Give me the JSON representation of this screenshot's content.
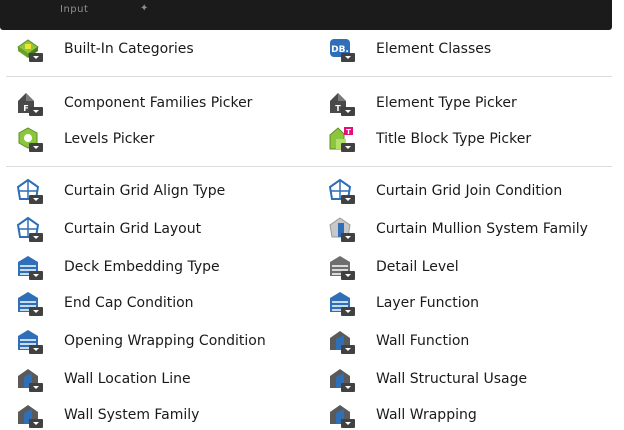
{
  "header": {
    "title": "Input",
    "pin_glyph": "✦"
  },
  "nodes": {
    "built_in_categories": {
      "label": "Built-In Categories",
      "icon": "categories-icon"
    },
    "element_classes": {
      "label": "Element Classes",
      "icon": "database-icon",
      "icon_text": "DB."
    },
    "component_families_picker": {
      "label": "Component Families Picker",
      "icon": "family-picker-icon",
      "icon_text": "F"
    },
    "element_type_picker": {
      "label": "Element Type Picker",
      "icon": "type-picker-icon",
      "icon_text": "T"
    },
    "levels_picker": {
      "label": "Levels Picker",
      "icon": "levels-icon"
    },
    "title_block_type_picker": {
      "label": "Title Block Type Picker",
      "icon": "title-block-icon",
      "icon_text": "T"
    },
    "curtain_grid_align_type": {
      "label": "Curtain Grid Align Type",
      "icon": "curtain-grid-icon"
    },
    "curtain_grid_join_condition": {
      "label": "Curtain Grid Join Condition",
      "icon": "curtain-grid-icon"
    },
    "curtain_grid_layout": {
      "label": "Curtain Grid Layout",
      "icon": "curtain-grid-icon"
    },
    "curtain_mullion_system_family": {
      "label": "Curtain Mullion System Family",
      "icon": "mullion-icon"
    },
    "deck_embedding_type": {
      "label": "Deck Embedding Type",
      "icon": "wall-layers-icon"
    },
    "detail_level": {
      "label": "Detail Level",
      "icon": "detail-level-icon"
    },
    "end_cap_condition": {
      "label": "End Cap Condition",
      "icon": "wall-layers-icon"
    },
    "layer_function": {
      "label": "Layer Function",
      "icon": "wall-layers-icon"
    },
    "opening_wrapping_condition": {
      "label": "Opening Wrapping Condition",
      "icon": "wall-layers-icon"
    },
    "wall_function": {
      "label": "Wall Function",
      "icon": "wall-icon"
    },
    "wall_location_line": {
      "label": "Wall Location Line",
      "icon": "wall-icon"
    },
    "wall_structural_usage": {
      "label": "Wall Structural Usage",
      "icon": "wall-icon"
    },
    "wall_system_family": {
      "label": "Wall System Family",
      "icon": "wall-icon"
    },
    "wall_wrapping": {
      "label": "Wall Wrapping",
      "icon": "wall-icon"
    }
  },
  "colors": {
    "header_bg": "#1b1b1b",
    "green": "#8cc63f",
    "blue": "#2f6fb7",
    "grey": "#5a5a5a",
    "magenta": "#e0117a"
  }
}
